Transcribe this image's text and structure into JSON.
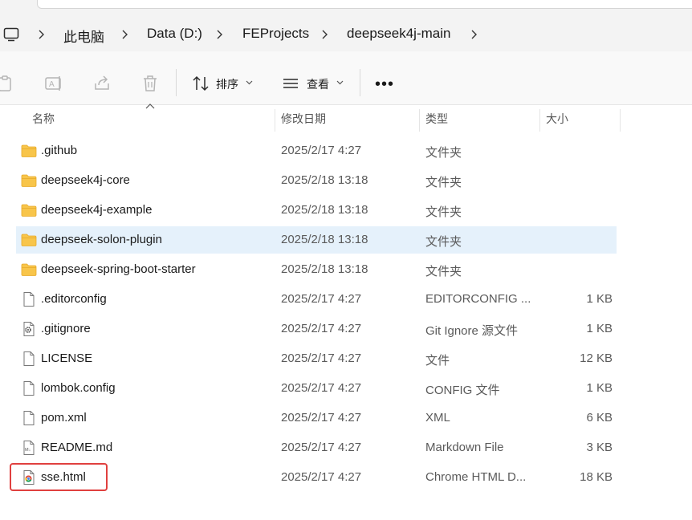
{
  "breadcrumb": [
    "此电脑",
    "Data (D:)",
    "FEProjects",
    "deepseek4j-main"
  ],
  "toolbar": {
    "sort_label": "排序",
    "view_label": "查看",
    "more_label": "•••"
  },
  "columns": {
    "name": "名称",
    "date": "修改日期",
    "type": "类型",
    "size": "大小"
  },
  "files": [
    {
      "name": ".github",
      "date": "2025/2/17 4:27",
      "type": "文件夹",
      "size": "",
      "icon": "folder-icon"
    },
    {
      "name": "deepseek4j-core",
      "date": "2025/2/18 13:18",
      "type": "文件夹",
      "size": "",
      "icon": "folder-icon"
    },
    {
      "name": "deepseek4j-example",
      "date": "2025/2/18 13:18",
      "type": "文件夹",
      "size": "",
      "icon": "folder-icon"
    },
    {
      "name": "deepseek-solon-plugin",
      "date": "2025/2/18 13:18",
      "type": "文件夹",
      "size": "",
      "icon": "folder-icon",
      "selected": true
    },
    {
      "name": "deepseek-spring-boot-starter",
      "date": "2025/2/18 13:18",
      "type": "文件夹",
      "size": "",
      "icon": "folder-icon"
    },
    {
      "name": ".editorconfig",
      "date": "2025/2/17 4:27",
      "type": "EDITORCONFIG ...",
      "size": "1 KB",
      "icon": "file-icon"
    },
    {
      "name": ".gitignore",
      "date": "2025/2/17 4:27",
      "type": "Git Ignore 源文件",
      "size": "1 KB",
      "icon": "gear-file-icon"
    },
    {
      "name": "LICENSE",
      "date": "2025/2/17 4:27",
      "type": "文件",
      "size": "12 KB",
      "icon": "file-icon"
    },
    {
      "name": "lombok.config",
      "date": "2025/2/17 4:27",
      "type": "CONFIG 文件",
      "size": "1 KB",
      "icon": "file-icon"
    },
    {
      "name": "pom.xml",
      "date": "2025/2/17 4:27",
      "type": "XML",
      "size": "6 KB",
      "icon": "file-icon"
    },
    {
      "name": "README.md",
      "date": "2025/2/17 4:27",
      "type": "Markdown File",
      "size": "3 KB",
      "icon": "markdown-file-icon"
    },
    {
      "name": "sse.html",
      "date": "2025/2/17 4:27",
      "type": "Chrome HTML D...",
      "size": "18 KB",
      "icon": "chrome-html-icon",
      "highlighted": true
    }
  ],
  "colors": {
    "selection": "#e5f1fb",
    "highlight_border": "#e0403f",
    "folder": "#f8c54a",
    "folder_dark": "#e6a92a"
  }
}
